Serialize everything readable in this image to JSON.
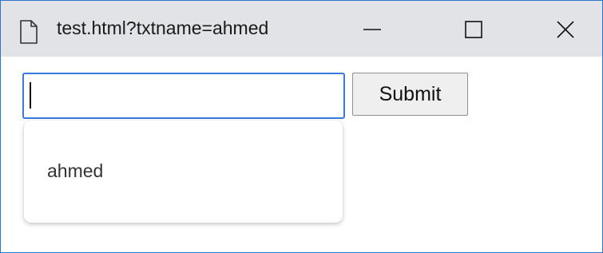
{
  "window": {
    "title": "test.html?txtname=ahmed"
  },
  "titlebar_icons": {
    "page": "page-icon",
    "minimize": "minimize-icon",
    "maximize": "maximize-icon",
    "close": "close-icon"
  },
  "form": {
    "input_value": "",
    "submit_label": "Submit"
  },
  "autocomplete": {
    "suggestions": [
      "ahmed"
    ]
  },
  "colors": {
    "titlebar": "#e1e3e6",
    "window_border": "#2a74c9",
    "input_focus_border": "#3a7ad9"
  }
}
